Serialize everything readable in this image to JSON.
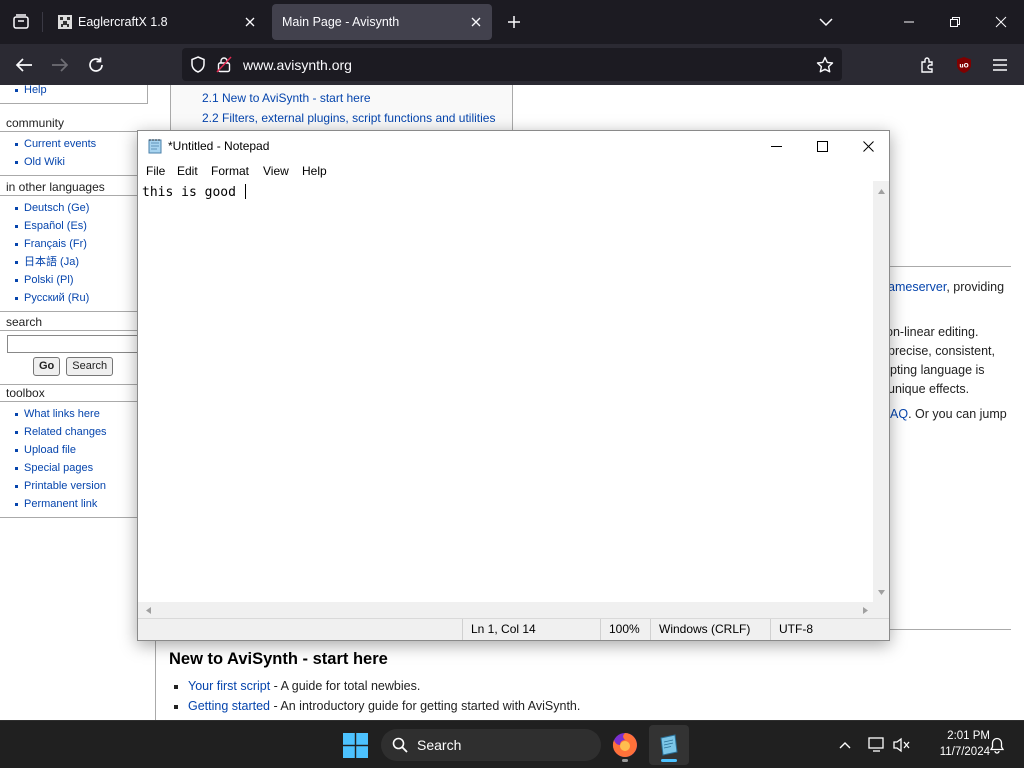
{
  "browser": {
    "tabs": [
      {
        "title": "EaglercraftX 1.8",
        "active": false
      },
      {
        "title": "Main Page - Avisynth",
        "active": true
      }
    ],
    "url": "www.avisynth.org",
    "icons": {
      "tab_list": "tab-list-icon",
      "new_tab": "plus-icon",
      "overflow": "chevron-down-icon",
      "back": "back-arrow-icon",
      "forward": "forward-arrow-icon",
      "reload": "reload-icon",
      "shield": "tracking-protection-shield-icon",
      "lock": "insecure-lock-icon",
      "bookmark": "star-icon",
      "extensions": "puzzle-piece-icon",
      "ublock": "ublock-origin-icon",
      "menu": "hamburger-menu-icon"
    }
  },
  "wiki": {
    "nav_items_top": [
      "Help"
    ],
    "community": {
      "heading": "community",
      "items": [
        "Current events",
        "Old Wiki"
      ]
    },
    "languages": {
      "heading": "in other languages",
      "items": [
        "Deutsch (Ge)",
        "Español (Es)",
        "Français (Fr)",
        "日本語 (Ja)",
        "Polski (Pl)",
        "Русский (Ru)"
      ]
    },
    "search": {
      "heading": "search",
      "go_label": "Go",
      "search_label": "Search"
    },
    "toolbox": {
      "heading": "toolbox",
      "items": [
        "What links here",
        "Related changes",
        "Upload file",
        "Special pages",
        "Printable version",
        "Permanent link"
      ]
    },
    "toc": [
      "2.1 New to AviSynth - start here",
      "2.2 Filters, external plugins, script functions and utilities"
    ],
    "intro_fragments": {
      "line1_link": "ameserver",
      "line1_rest": ", providing",
      "line2": "on-linear editing.",
      "line3": " precise, consistent,",
      "line4": "pting language is",
      "line5": " unique effects.",
      "line6_link": "AQ",
      "line6_rest": ". Or you can jump"
    },
    "section_heading": "New to AviSynth - start here",
    "bullets": [
      {
        "link": "Your first script",
        "rest": " - A guide for total newbies."
      },
      {
        "link": "Getting started",
        "rest": " - An introductory guide for getting started with AviSynth."
      }
    ]
  },
  "notepad": {
    "title": "*Untitled - Notepad",
    "menu": [
      "File",
      "Edit",
      "Format",
      "View",
      "Help"
    ],
    "text": "this is good ",
    "status": {
      "position": "Ln 1, Col 14",
      "zoom": "100%",
      "line_ending": "Windows (CRLF)",
      "encoding": "UTF-8"
    }
  },
  "taskbar": {
    "search_label": "Search",
    "time": "2:01 PM",
    "date": "11/7/2024",
    "apps": [
      "firefox-icon",
      "notepad-icon"
    ]
  },
  "colors": {
    "browser_dark": "#1c1b22",
    "navbar": "#2b2a33",
    "active_tab": "#42414d",
    "wiki_link": "#0645ad",
    "taskbar": "#202020"
  }
}
